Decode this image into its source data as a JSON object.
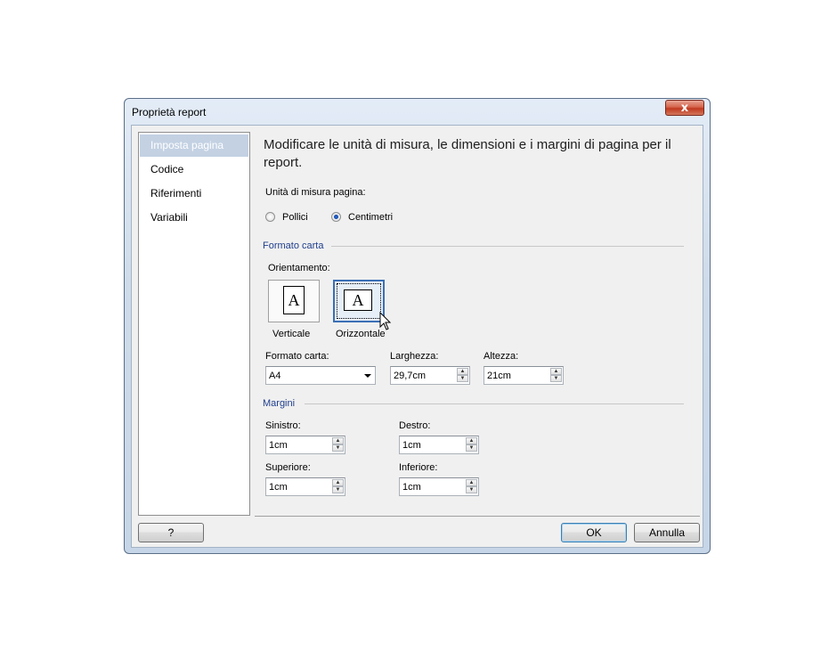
{
  "window": {
    "title": "Proprietà report",
    "close_label": "x"
  },
  "nav": {
    "items": [
      {
        "label": "Imposta pagina",
        "selected": true
      },
      {
        "label": "Codice"
      },
      {
        "label": "Riferimenti"
      },
      {
        "label": "Variabili"
      }
    ]
  },
  "content": {
    "heading": "Modificare le unità di misura, le dimensioni e i margini di pagina per il report.",
    "units": {
      "label": "Unità di misura pagina:",
      "options": [
        {
          "label": "Pollici",
          "checked": false
        },
        {
          "label": "Centimetri",
          "checked": true
        }
      ]
    },
    "paper": {
      "group_title": "Formato carta",
      "orientation_label": "Orientamento:",
      "portrait_label": "Verticale",
      "landscape_label": "Orizzontale",
      "icon_letter": "A",
      "selected_orientation": "Orizzontale",
      "size_label": "Formato carta:",
      "size_value": "A4",
      "width_label": "Larghezza:",
      "width_value": "29,7cm",
      "height_label": "Altezza:",
      "height_value": "21cm"
    },
    "margins": {
      "group_title": "Margini",
      "left_label": "Sinistro:",
      "left_value": "1cm",
      "right_label": "Destro:",
      "right_value": "1cm",
      "top_label": "Superiore:",
      "top_value": "1cm",
      "bottom_label": "Inferiore:",
      "bottom_value": "1cm"
    }
  },
  "buttons": {
    "help": "?",
    "ok": "OK",
    "cancel": "Annulla"
  },
  "colors": {
    "accent": "#3a6fb5",
    "group_title": "#1f3e8d",
    "nav_selected": "#c3d1e3"
  }
}
